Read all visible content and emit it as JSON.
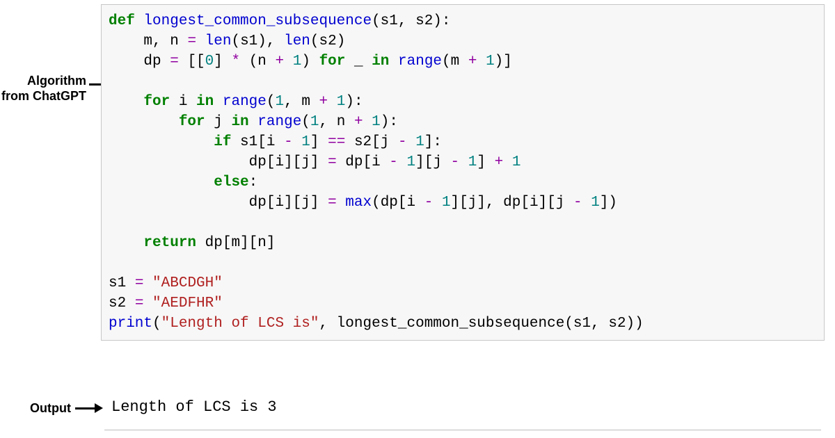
{
  "labels": {
    "algorithm_line1": "Algorithm",
    "algorithm_line2": "from ChatGPT",
    "output": "Output"
  },
  "code": {
    "def": "def",
    "func_name": "longest_common_subsequence",
    "params": "(s1, s2):",
    "l2_a": "m, n ",
    "l2_eq": "=",
    "l2_len": "len",
    "l2_b": "(s1), ",
    "l2_c": "(s2)",
    "l3_a": "dp ",
    "l3_eq": "=",
    "l3_b": " [[",
    "l3_zero": "0",
    "l3_c": "] ",
    "l3_mul": "*",
    "l3_d": " (n ",
    "l3_plus": "+",
    "l3_sp": " ",
    "l3_one": "1",
    "l3_e": ") ",
    "l3_for": "for",
    "l3_f": " _ ",
    "l3_in": "in",
    "l3_g": " ",
    "l3_range": "range",
    "l3_h": "(m ",
    "l3_i": ")]",
    "l5_for": "for",
    "l5_a": " i ",
    "l5_in": "in",
    "l5_b": " ",
    "l5_range": "range",
    "l5_c": "(",
    "l5_d": ", m ",
    "l5_plus": "+",
    "l5_e": "):",
    "l6_for": "for",
    "l6_a": " j ",
    "l6_in": "in",
    "l6_range": "range",
    "l6_d": ", n ",
    "l7_if": "if",
    "l7_a": " s1[i ",
    "l7_minus": "-",
    "l7_b": "] ",
    "l7_eqeq": "==",
    "l7_c": " s2[j ",
    "l7_d": "]:",
    "l8_a": "dp[i][j] ",
    "l8_eq": "=",
    "l8_b": " dp[i ",
    "l8_c": "][j ",
    "l8_d": "] ",
    "l9_else": "else",
    "l9_colon": ":",
    "l10_a": "dp[i][j] ",
    "l10_eq": "=",
    "l10_max": "max",
    "l10_b": "(dp[i ",
    "l10_c": "][j], dp[i][j ",
    "l10_d": "])",
    "l12_return": "return",
    "l12_a": " dp[m][n]",
    "l14_a": "s1 ",
    "l14_str": "\"ABCDGH\"",
    "l15_a": "s2 ",
    "l15_str": "\"AEDFHR\"",
    "l16_print": "print",
    "l16_a": "(",
    "l16_str": "\"Length of LCS is\"",
    "l16_b": ", longest_common_subsequence(s1, s2))"
  },
  "output_text": "Length of LCS is 3",
  "colors": {
    "box_bg": "#f7f7f7",
    "box_border": "#c7c7c7",
    "keyword": "#008000",
    "function": "#0000d0",
    "number": "#008080",
    "operator": "#9000a0",
    "string": "#b02020"
  }
}
